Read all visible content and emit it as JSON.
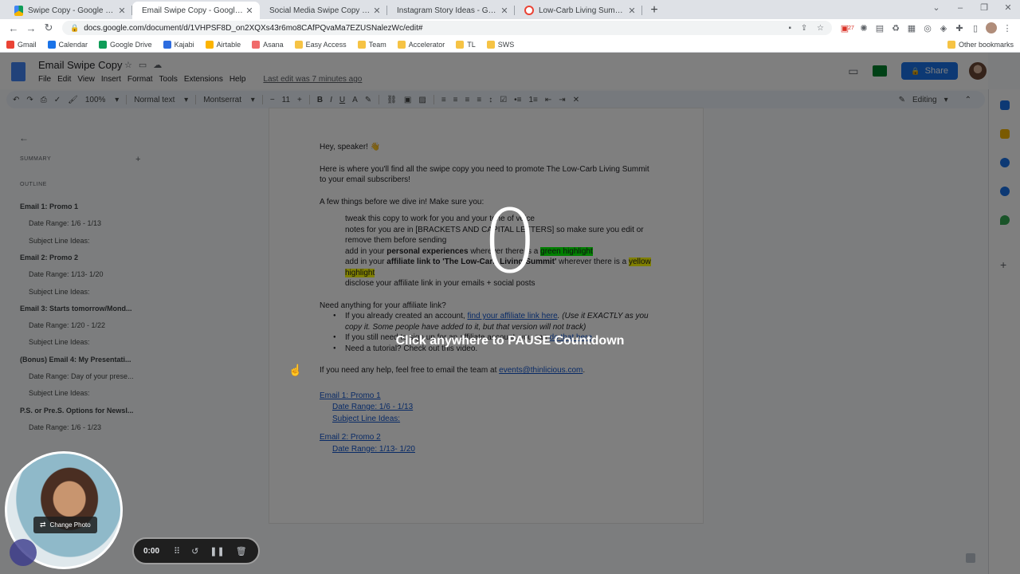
{
  "browser": {
    "tabs": [
      {
        "title": "Swipe Copy - Google Drive",
        "icon": "drive-icon",
        "active": false
      },
      {
        "title": "Email Swipe Copy - Google Docs",
        "icon": "docs-icon",
        "active": true
      },
      {
        "title": "Social Media Swipe Copy - Google Docs",
        "icon": "docs-icon",
        "active": false
      },
      {
        "title": "Instagram Story Ideas - Google Docs",
        "icon": "docs-icon",
        "active": false
      },
      {
        "title": "Low-Carb Living Summit: Speakers",
        "icon": "google-icon",
        "active": false
      }
    ],
    "close_glyph": "✕",
    "new_tab": "+",
    "url": "docs.google.com/document/d/1VHPSF8D_on2XQXs43r6mo8CAfPQvaMa7EZUSNalezWc/edit#",
    "extension_badge": "27",
    "bookmarks": [
      {
        "label": "Gmail",
        "icon": "gmail-icon"
      },
      {
        "label": "Calendar",
        "icon": "calendar-icon"
      },
      {
        "label": "Google Drive",
        "icon": "drive-icon"
      },
      {
        "label": "Kajabi",
        "icon": "kajabi-icon"
      },
      {
        "label": "Airtable",
        "icon": "airtable-icon"
      },
      {
        "label": "Asana",
        "icon": "asana-icon"
      },
      {
        "label": "Easy Access",
        "icon": "folder-icon"
      },
      {
        "label": "Team",
        "icon": "folder-icon"
      },
      {
        "label": "Accelerator",
        "icon": "folder-icon"
      },
      {
        "label": "TL",
        "icon": "folder-icon"
      },
      {
        "label": "SWS",
        "icon": "folder-icon"
      }
    ],
    "other_bookmarks": "Other bookmarks"
  },
  "docs": {
    "title": "Email Swipe Copy",
    "menu": [
      "File",
      "Edit",
      "View",
      "Insert",
      "Format",
      "Tools",
      "Extensions",
      "Help"
    ],
    "last_edit": "Last edit was 7 minutes ago",
    "share_label": "Share",
    "toolbar": {
      "zoom": "100%",
      "style": "Normal text",
      "font": "Montserrat",
      "font_size": "11",
      "mode": "Editing"
    },
    "outline": {
      "summary_label": "SUMMARY",
      "outline_label": "OUTLINE",
      "items": [
        {
          "text": "Email 1: Promo 1",
          "level": 1
        },
        {
          "text": "Date Range: 1/6 - 1/13",
          "level": 2
        },
        {
          "text": "Subject Line Ideas:",
          "level": 2
        },
        {
          "text": "Email 2: Promo 2",
          "level": 1
        },
        {
          "text": "Date Range: 1/13- 1/20",
          "level": 2
        },
        {
          "text": "Subject Line Ideas:",
          "level": 2
        },
        {
          "text": "Email 3: Starts tomorrow/Mond...",
          "level": 1
        },
        {
          "text": "Date Range: 1/20 - 1/22",
          "level": 2
        },
        {
          "text": "Subject Line Ideas:",
          "level": 2
        },
        {
          "text": "(Bonus) Email 4: My Presentati...",
          "level": 1
        },
        {
          "text": "Date Range: Day of your prese...",
          "level": 2
        },
        {
          "text": "Subject Line Ideas:",
          "level": 2
        },
        {
          "text": "P.S. or Pre.S. Options for Newsl...",
          "level": 1
        },
        {
          "text": "Date Range: 1/6 - 1/23",
          "level": 2
        }
      ]
    },
    "body": {
      "greeting": "Hey, speaker! 👋",
      "intro": "Here is where you'll find all the swipe copy you need to promote The Low-Carb Living Summit to your email subscribers!",
      "before": "A few things before we dive in! Make sure you:",
      "list1_a": "tweak this copy to work for you and your tone of voice",
      "list1_b": "notes for you are in [BRACKETS AND CAPITAL LETTERS] so make sure you edit or remove them before sending",
      "list1_c_pre": "add in your ",
      "list1_c_bold": "personal experiences",
      "list1_c_mid": " wherever there is a ",
      "list1_c_hl": "green highlight",
      "list1_d_pre": "add in your ",
      "list1_d_bold": "affiliate link to 'The Low-Carb Living Summit'",
      "list1_d_mid": " wherever there is a ",
      "list1_d_hl": "yellow highlight",
      "list1_e": "disclose your affiliate link in your emails + social posts",
      "need": "Need anything for your affiliate link?",
      "list2_a_pre": "If you already created an account, ",
      "list2_a_link": "find your affiliate link here",
      "list2_a_it": ". (Use it EXACTLY as you copy it. Some people have added to it, but that version will not track)",
      "list2_b_pre": "If you still need to sign up for an affiliate account, you can ",
      "list2_b_link": "do that here",
      "list2_b_post": ".",
      "list2_c": "Need a tutorial? Check out this video.",
      "help_pre": "If you need any help, feel free to email the team at ",
      "help_link": "events@thinlicious.com",
      "help_post": ".",
      "toc": [
        {
          "text": "Email 1: Promo 1",
          "indent": false
        },
        {
          "text": "Date Range: 1/6 - 1/13",
          "indent": true
        },
        {
          "text": "Subject Line Ideas:",
          "indent": true
        },
        {
          "text": "Email 2: Promo 2",
          "indent": false
        },
        {
          "text": "Date Range: 1/13- 1/20",
          "indent": true
        }
      ]
    }
  },
  "recorder": {
    "countdown": "0",
    "pause_hint": "Click anywhere to PAUSE Countdown",
    "change_photo": "Change Photo",
    "timer": "0:00"
  },
  "colors": {
    "accent": "#1a73e8",
    "highlight_green": "#00ff00",
    "highlight_yellow": "#ffff00",
    "overlay": "#000000"
  }
}
